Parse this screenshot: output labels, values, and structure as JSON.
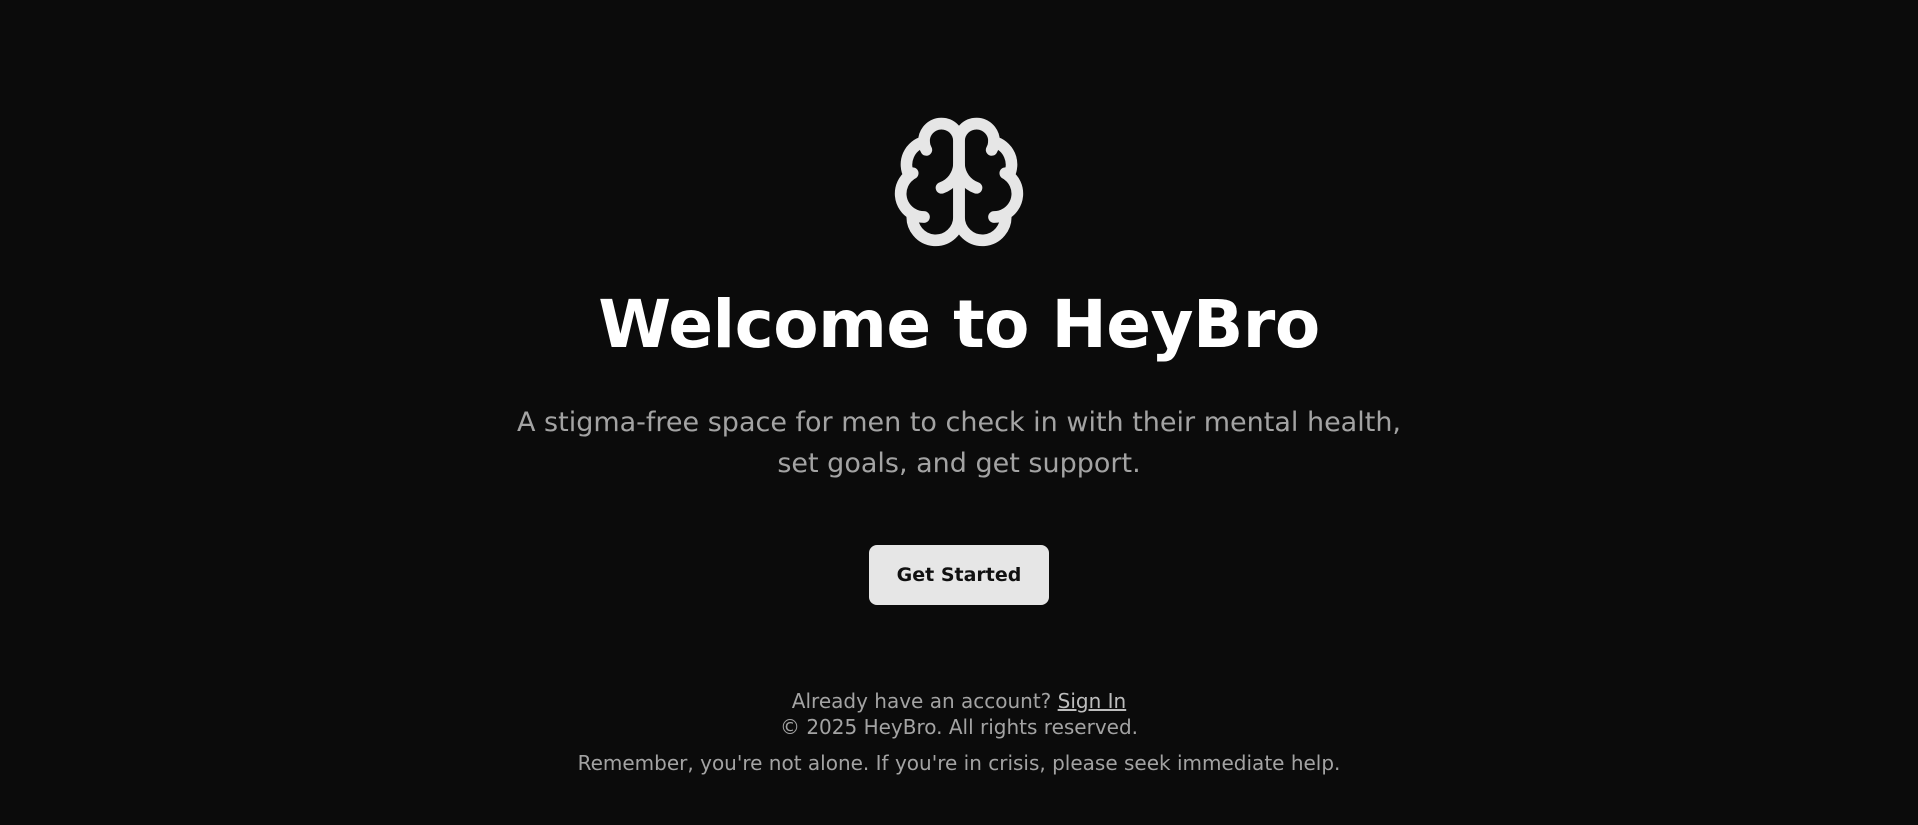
{
  "logo": {
    "icon": "brain-icon",
    "color": "#e6e6e6"
  },
  "hero": {
    "title": "Welcome to HeyBro",
    "subtitle_line1": "A stigma-free space for men to check in with their mental health,",
    "subtitle_line2": "set goals, and get support.",
    "cta_label": "Get Started"
  },
  "footer": {
    "account_prompt": "Already have an account?",
    "signin_label": "Sign In",
    "copyright": "© 2025 HeyBro. All rights reserved.",
    "crisis_notice": "Remember, you're not alone. If you're in crisis, please seek immediate help."
  },
  "colors": {
    "background": "#0b0b0b",
    "heading": "#ffffff",
    "muted_text": "#a3a3a3",
    "button_bg": "#e6e6e6",
    "button_text": "#111111"
  }
}
